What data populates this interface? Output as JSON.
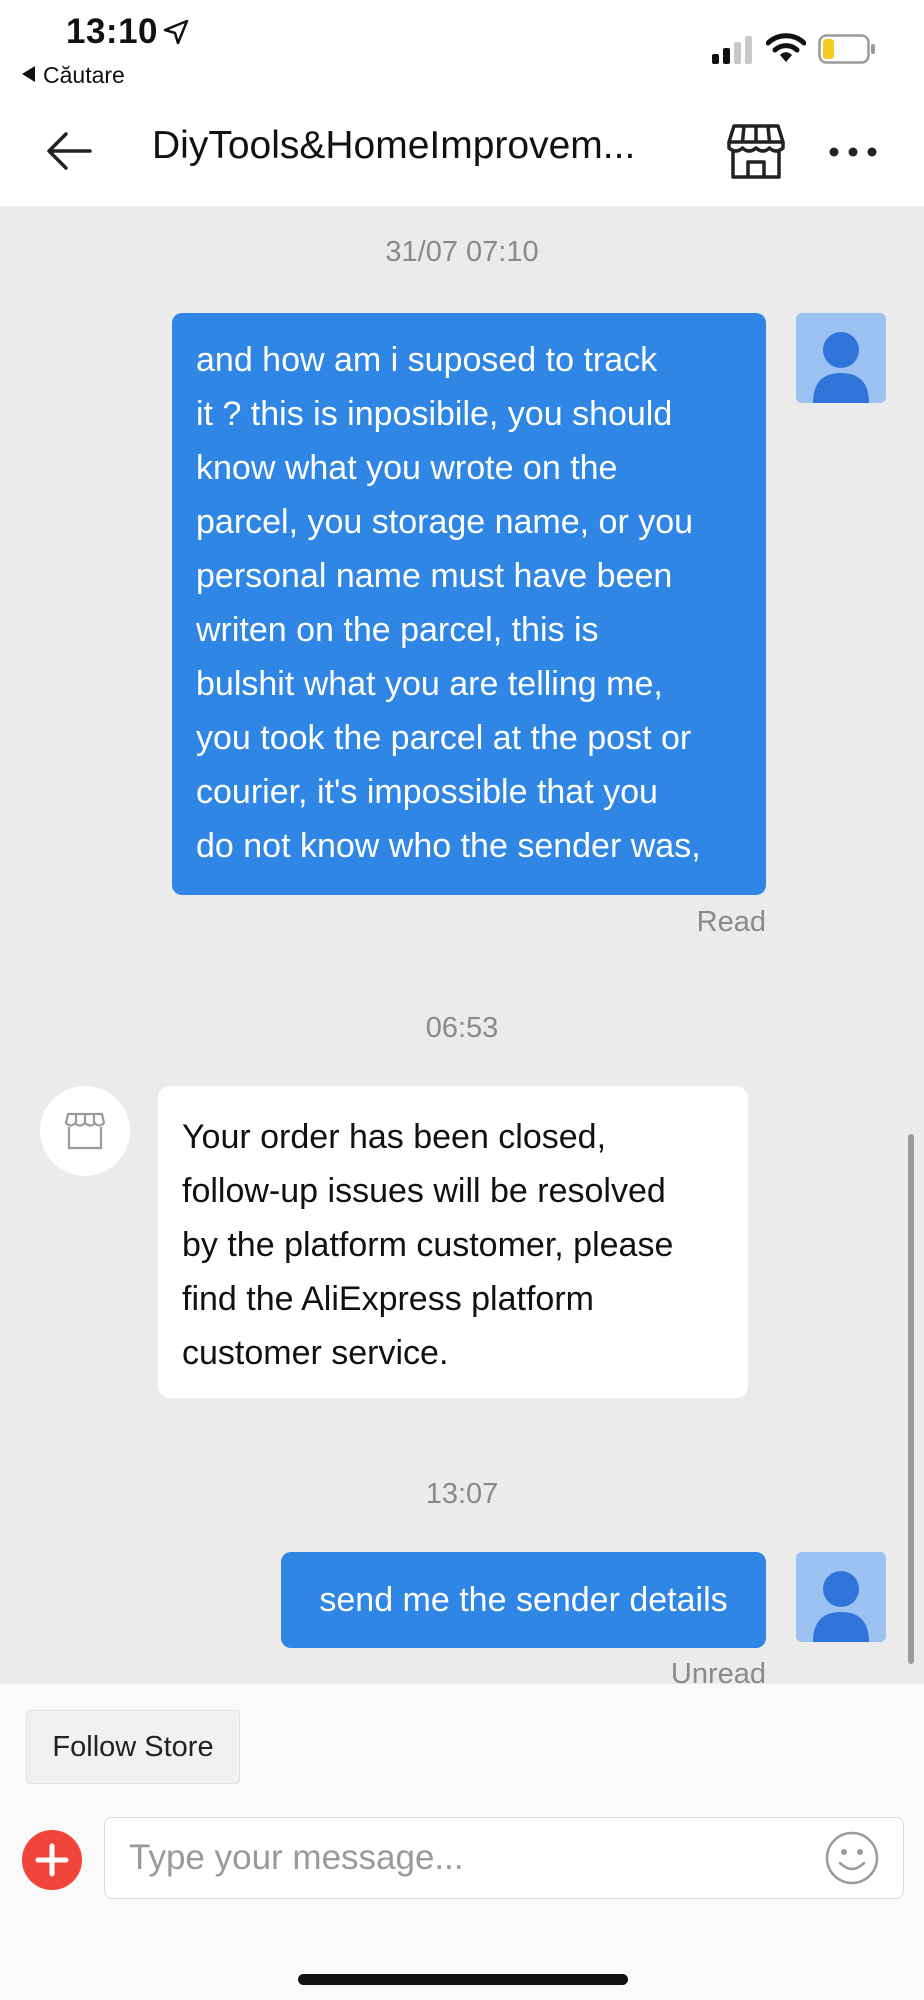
{
  "status_bar": {
    "time": "13:10",
    "back_app_label": "Căutare"
  },
  "header": {
    "title": "DiyTools&HomeImprovem..."
  },
  "messages": [
    {
      "timestamp": "31/07 07:10",
      "sender": "user",
      "lines": [
        "and how am i suposed to track",
        "it ? this is inposibile, you should",
        "know what you wrote on the",
        "parcel, you storage name, or you",
        "personal name must have been",
        "writen on the parcel, this is",
        "bulshit what you are telling me,",
        "you took the parcel at the post or",
        "courier, it's impossible that you",
        "do not know who the sender was,"
      ],
      "status": "Read"
    },
    {
      "timestamp": "06:53",
      "sender": "store",
      "lines": [
        "Your order has been closed,",
        "follow-up issues will be resolved",
        "by the platform customer, please",
        "find the AliExpress platform",
        "customer service."
      ]
    },
    {
      "timestamp": "13:07",
      "sender": "user",
      "lines": [
        "send me the sender details"
      ],
      "status": "Unread"
    }
  ],
  "footer": {
    "follow_label": "Follow Store",
    "input_placeholder": "Type your message..."
  },
  "colors": {
    "user_bubble": "#2f86e4",
    "chat_background": "#ebebeb",
    "plus_button": "#f0463a",
    "user_avatar": "#9cc1f3"
  },
  "icons": [
    "location-arrow-icon",
    "signal-icon",
    "wifi-icon",
    "battery-icon",
    "back-arrow-icon",
    "store-icon",
    "more-icon",
    "user-avatar-icon",
    "store-avatar-icon",
    "plus-icon",
    "smiley-icon"
  ]
}
